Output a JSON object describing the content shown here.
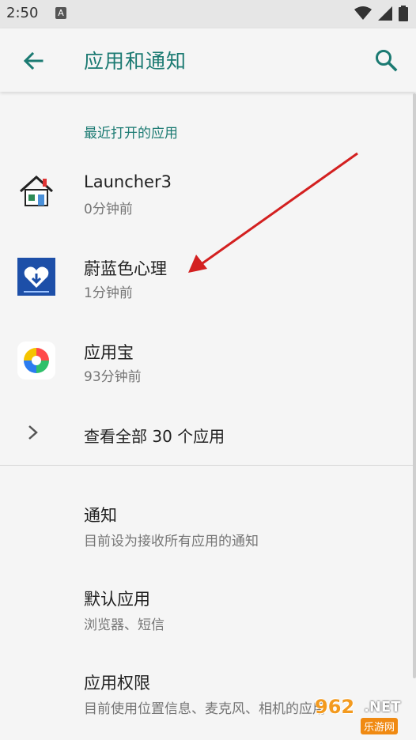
{
  "status_bar": {
    "time": "2:50",
    "notification_letter": "A"
  },
  "app_bar": {
    "title": "应用和通知"
  },
  "recent": {
    "section_title": "最近打开的应用",
    "apps": [
      {
        "name": "Launcher3",
        "time": "0分钟前",
        "icon": "launcher3-house-icon"
      },
      {
        "name": "蔚蓝色心理",
        "time": "1分钟前",
        "icon": "blue-heart-app-icon"
      },
      {
        "name": "应用宝",
        "time": "93分钟前",
        "icon": "yingyongbao-icon"
      }
    ],
    "see_all": "查看全部 30 个应用"
  },
  "prefs": [
    {
      "title": "通知",
      "summary": "目前设为接收所有应用的通知"
    },
    {
      "title": "默认应用",
      "summary": "浏览器、短信"
    },
    {
      "title": "应用权限",
      "summary": "目前使用位置信息、麦克风、相机的应用"
    }
  ],
  "watermark": {
    "number": "962",
    "domain": ".NET",
    "site": "乐游网"
  },
  "colors": {
    "accent": "#1b7a72",
    "arrow": "#d32020",
    "background": "#f5f5f5"
  }
}
